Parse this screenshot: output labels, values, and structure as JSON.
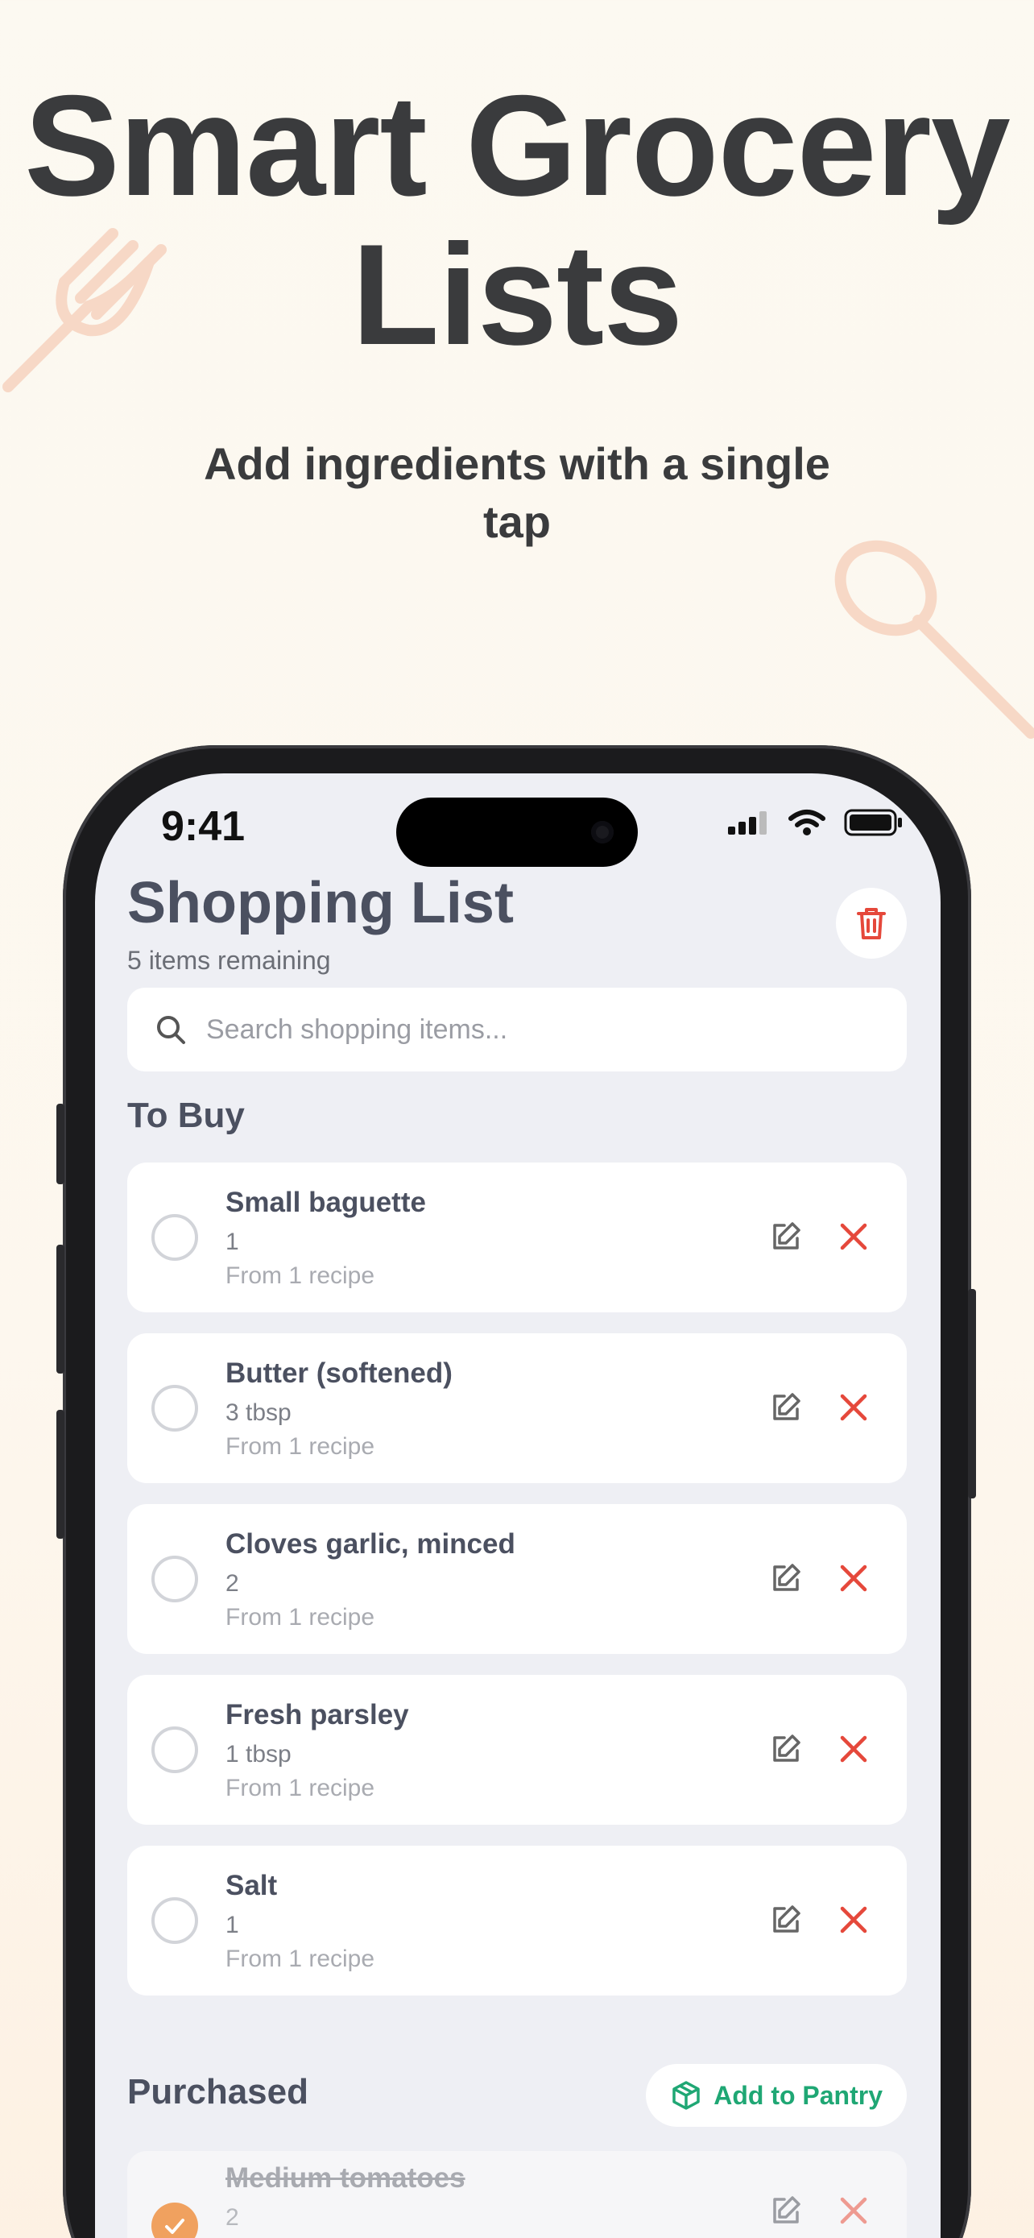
{
  "promo": {
    "headline_line1": "Smart Grocery",
    "headline_line2": "Lists",
    "subheadline": "Add ingredients with a single tap"
  },
  "status_bar": {
    "time": "9:41"
  },
  "app": {
    "title": "Shopping List",
    "subtitle": "5 items remaining",
    "search_placeholder": "Search shopping items..."
  },
  "to_buy": {
    "title": "To Buy",
    "items": [
      {
        "name": "Small baguette",
        "qty": "1",
        "source": "From 1 recipe"
      },
      {
        "name": "Butter (softened)",
        "qty": "3 tbsp",
        "source": "From 1 recipe"
      },
      {
        "name": "Cloves garlic, minced",
        "qty": "2",
        "source": "From 1 recipe"
      },
      {
        "name": "Fresh parsley",
        "qty": "1 tbsp",
        "source": "From 1 recipe"
      },
      {
        "name": "Salt",
        "qty": "1",
        "source": "From 1 recipe"
      }
    ]
  },
  "purchased": {
    "title": "Purchased",
    "add_to_pantry_label": "Add to Pantry",
    "items": [
      {
        "name": "Medium tomatoes",
        "qty": "2"
      }
    ]
  },
  "colors": {
    "accent_orange": "#f0a15f",
    "delete_red": "#e5483b",
    "pantry_green": "#1fa774",
    "background": "#fcf9f1"
  },
  "icons": {
    "search": "search-icon",
    "trash": "trash-icon",
    "edit": "edit-icon",
    "delete": "close-icon",
    "pantry": "box-icon",
    "check": "check-icon"
  }
}
